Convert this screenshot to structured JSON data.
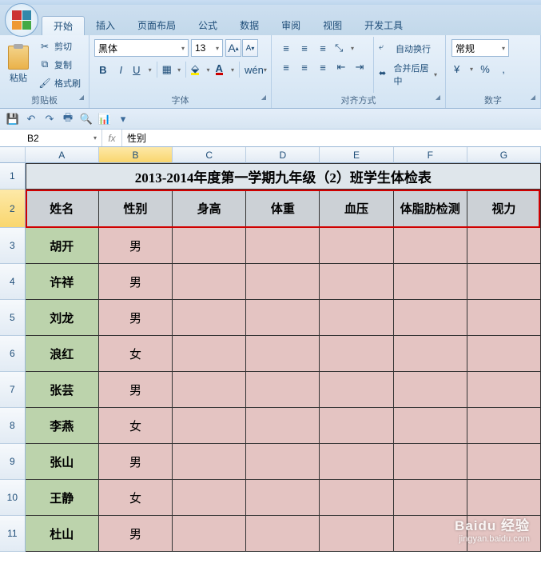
{
  "tabs": {
    "t0": "开始",
    "t1": "插入",
    "t2": "页面布局",
    "t3": "公式",
    "t4": "数据",
    "t5": "审阅",
    "t6": "视图",
    "t7": "开发工具"
  },
  "clipboard": {
    "group": "剪贴板",
    "paste": "粘贴",
    "cut": "剪切",
    "copy": "复制",
    "format": "格式刷"
  },
  "font": {
    "group": "字体",
    "name": "黑体",
    "size": "13",
    "growA": "A",
    "shrinkA": "A",
    "bold": "B",
    "italic": "I",
    "underline": "U"
  },
  "align": {
    "group": "对齐方式",
    "wrap": "自动换行",
    "merge": "合并后居中"
  },
  "number": {
    "group": "数字",
    "format": "常规"
  },
  "namebox": "B2",
  "formula": "性别",
  "cols": {
    "A": "A",
    "B": "B",
    "C": "C",
    "D": "D",
    "E": "E",
    "F": "F",
    "G": "G"
  },
  "title": "2013-2014年度第一学期九年级（2）班学生体检表",
  "headers": {
    "h0": "姓名",
    "h1": "性别",
    "h2": "身高",
    "h3": "体重",
    "h4": "血压",
    "h5": "体脂肪检测",
    "h6": "视力"
  },
  "rows": [
    {
      "n": "3",
      "name": "胡开",
      "sex": "男"
    },
    {
      "n": "4",
      "name": "许祥",
      "sex": "男"
    },
    {
      "n": "5",
      "name": "刘龙",
      "sex": "男"
    },
    {
      "n": "6",
      "name": "浪红",
      "sex": "女"
    },
    {
      "n": "7",
      "name": "张芸",
      "sex": "男"
    },
    {
      "n": "8",
      "name": "李燕",
      "sex": "女"
    },
    {
      "n": "9",
      "name": "张山",
      "sex": "男"
    },
    {
      "n": "10",
      "name": "王静",
      "sex": "女"
    },
    {
      "n": "11",
      "name": "杜山",
      "sex": "男"
    }
  ],
  "wm": {
    "brand": "Baidu 经验",
    "url": "jingyan.baidu.com"
  }
}
